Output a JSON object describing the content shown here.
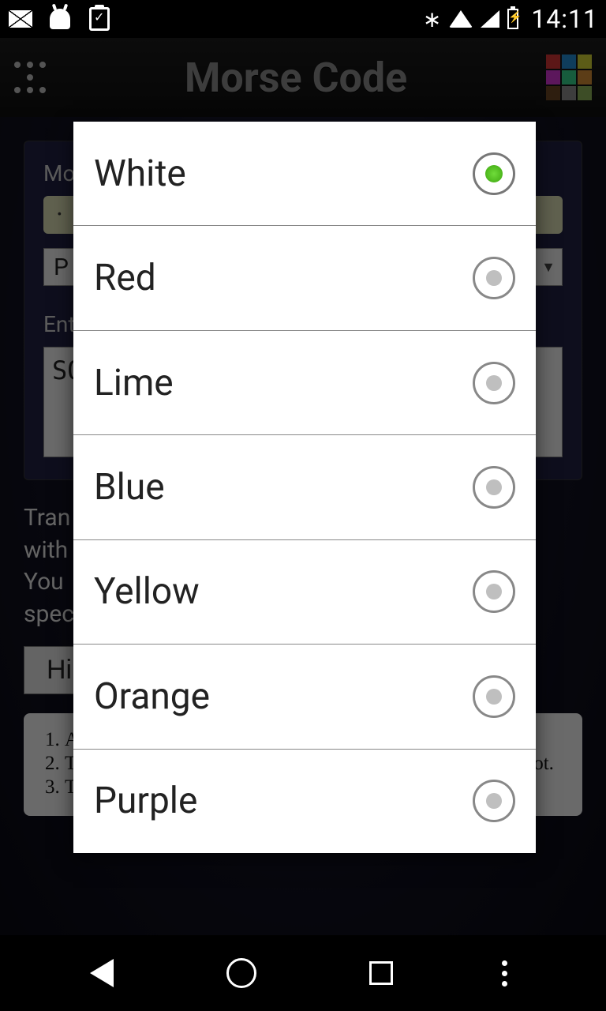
{
  "status": {
    "time": "14:11"
  },
  "header": {
    "title": "Morse Code"
  },
  "panel": {
    "morse_label": "Mor",
    "morse_value": "· · ·",
    "dropdown1": "P",
    "enter_label": "Ente",
    "text_value": "SO"
  },
  "desc": "Tran\nwith\nYou\nspec",
  "hide_label": "Hi",
  "rules": [
    "A dash is equal to three dots.",
    "The space between parts of the same letter is equal to one dot.",
    "The space between two letters is equal to three dots."
  ],
  "dialog": {
    "options": [
      {
        "label": "White",
        "selected": true
      },
      {
        "label": "Red",
        "selected": false
      },
      {
        "label": "Lime",
        "selected": false
      },
      {
        "label": "Blue",
        "selected": false
      },
      {
        "label": "Yellow",
        "selected": false
      },
      {
        "label": "Orange",
        "selected": false
      },
      {
        "label": "Purple",
        "selected": false
      }
    ]
  }
}
